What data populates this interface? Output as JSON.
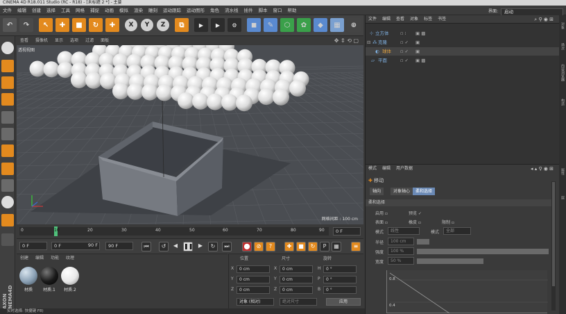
{
  "window": {
    "title": "CINEMA 4D R18.011 Studio (RC - R18) - [未标题 2 *] - 主要"
  },
  "menu": [
    "文件",
    "编辑",
    "创建",
    "选择",
    "工具",
    "网格",
    "捕捉",
    "动画",
    "模拟",
    "渲染",
    "雕刻",
    "运动跟踪",
    "运动图形",
    "角色",
    "流水线",
    "插件",
    "脚本",
    "窗口",
    "帮助"
  ],
  "layout": {
    "label": "界面:",
    "value": "启动"
  },
  "viewport": {
    "menu": [
      "查看",
      "摄像机",
      "显示",
      "选项",
      "过滤",
      "面板"
    ],
    "label": "透视视图",
    "grid_info": "网格间距 : 100 cm"
  },
  "timeline": {
    "ticks": [
      "0",
      "10",
      "20",
      "30",
      "40",
      "50",
      "60",
      "70",
      "80",
      "90"
    ],
    "end_frame": "0 F",
    "current": "10"
  },
  "transport": {
    "start": "0 F",
    "range_start": "0 F",
    "range_end": "90 F",
    "end": "90 F"
  },
  "materials": {
    "menu": [
      "创建",
      "编辑",
      "功能",
      "纹理"
    ],
    "items": [
      {
        "label": "材质",
        "color": "#8aa0b4"
      },
      {
        "label": "材质.1",
        "color": "#1a1a1a"
      },
      {
        "label": "材质.2",
        "color": "#e8e8e8"
      }
    ]
  },
  "coords": {
    "headers": [
      "位置",
      "尺寸",
      "旋转"
    ],
    "rows": [
      {
        "axis": "X",
        "pos": "0 cm",
        "size": "0 cm",
        "rot_axis": "H",
        "rot": "0 °"
      },
      {
        "axis": "Y",
        "pos": "0 cm",
        "size": "0 cm",
        "rot_axis": "P",
        "rot": "0 °"
      },
      {
        "axis": "Z",
        "pos": "0 cm",
        "size": "0 cm",
        "rot_axis": "B",
        "rot": "0 °"
      }
    ],
    "mode": "对象 (相对)",
    "size_mode": "绝对尺寸",
    "apply": "应用"
  },
  "objects": {
    "menu": [
      "文件",
      "编辑",
      "查看",
      "对象",
      "标签",
      "书签"
    ],
    "items": [
      {
        "name": "立方体",
        "color": "#7fb0e0",
        "indent": 0
      },
      {
        "name": "克隆",
        "color": "#7fb0e0",
        "indent": 0
      },
      {
        "name": "球体",
        "color": "#e0a040",
        "indent": 1
      },
      {
        "name": "平面",
        "color": "#7fb0e0",
        "indent": 0
      }
    ]
  },
  "attributes": {
    "menu": [
      "模式",
      "编辑",
      "用户数据"
    ],
    "title": "移动",
    "tabs": [
      "轴向",
      "对象轴心",
      "柔和选择"
    ],
    "section": "柔和选择",
    "rows": {
      "enable": "启用",
      "preview": "预览",
      "surface": "表面",
      "rubber": "橡皮",
      "limit": "限制",
      "mode_label": "模式",
      "mode_value": "线性",
      "shape_label": "模式",
      "shape_value": "全部",
      "radius_label": "半径",
      "radius_value": "100 cm",
      "strength_label": "强度",
      "strength_value": "100 %",
      "width_label": "宽度",
      "width_value": "50 %"
    },
    "graph_labels": [
      "0.8",
      "0.4"
    ]
  },
  "status": "实时选择: 快捷键 F8)",
  "right_tabs": [
    "对象",
    "场次",
    "内容浏览器",
    "构造",
    "属性",
    "层"
  ]
}
